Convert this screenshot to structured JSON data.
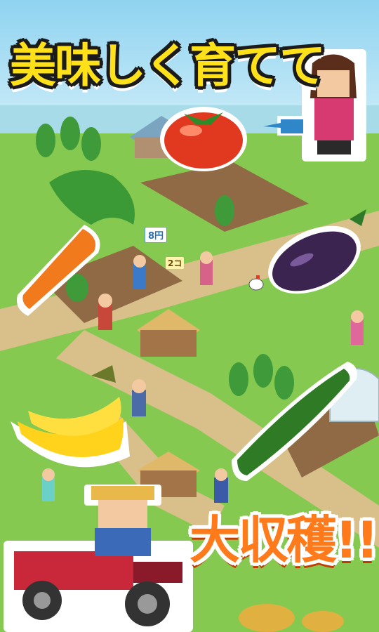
{
  "banner": {
    "top_text": "美味しく育てて",
    "bottom_text": "大収穫!!"
  },
  "labels": {
    "price_tag": "8円",
    "quantity_tag": "2コ"
  },
  "colors": {
    "sky": "#8fd3f0",
    "grass": "#7cc24a",
    "path": "#d9c08a",
    "title_yellow": "#ffe11a",
    "title_orange": "#ff7a1a"
  },
  "icons": [
    "tomato-icon",
    "carrot-icon",
    "eggplant-icon",
    "banana-icon",
    "cucumber-icon",
    "tractor-icon",
    "farmer-icon",
    "watering-can-icon",
    "house-icon",
    "chicken-icon"
  ]
}
